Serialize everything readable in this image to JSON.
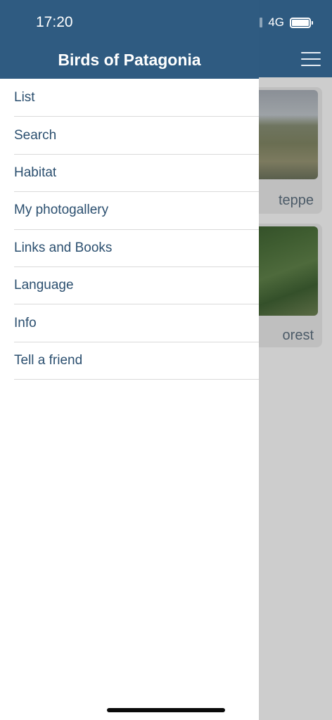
{
  "status_bar": {
    "time": "17:20",
    "network": "4G",
    "battery_level": 1.0
  },
  "app": {
    "title": "Birds of Patagonia"
  },
  "menu": {
    "items": [
      {
        "label": "List"
      },
      {
        "label": "Search"
      },
      {
        "label": "Habitat"
      },
      {
        "label": "My photogallery"
      },
      {
        "label": "Links and Books"
      },
      {
        "label": "Language"
      },
      {
        "label": "Info"
      },
      {
        "label": "Tell a friend"
      }
    ]
  },
  "background": {
    "cards": [
      {
        "caption": "teppe"
      },
      {
        "caption": "orest"
      }
    ]
  },
  "colors": {
    "header": "#2f5b81",
    "menu_text": "#2b4f6f",
    "overlay": "#cdcdcd"
  },
  "icons": [
    "hamburger-menu-icon",
    "signal-icon",
    "battery-icon"
  ]
}
